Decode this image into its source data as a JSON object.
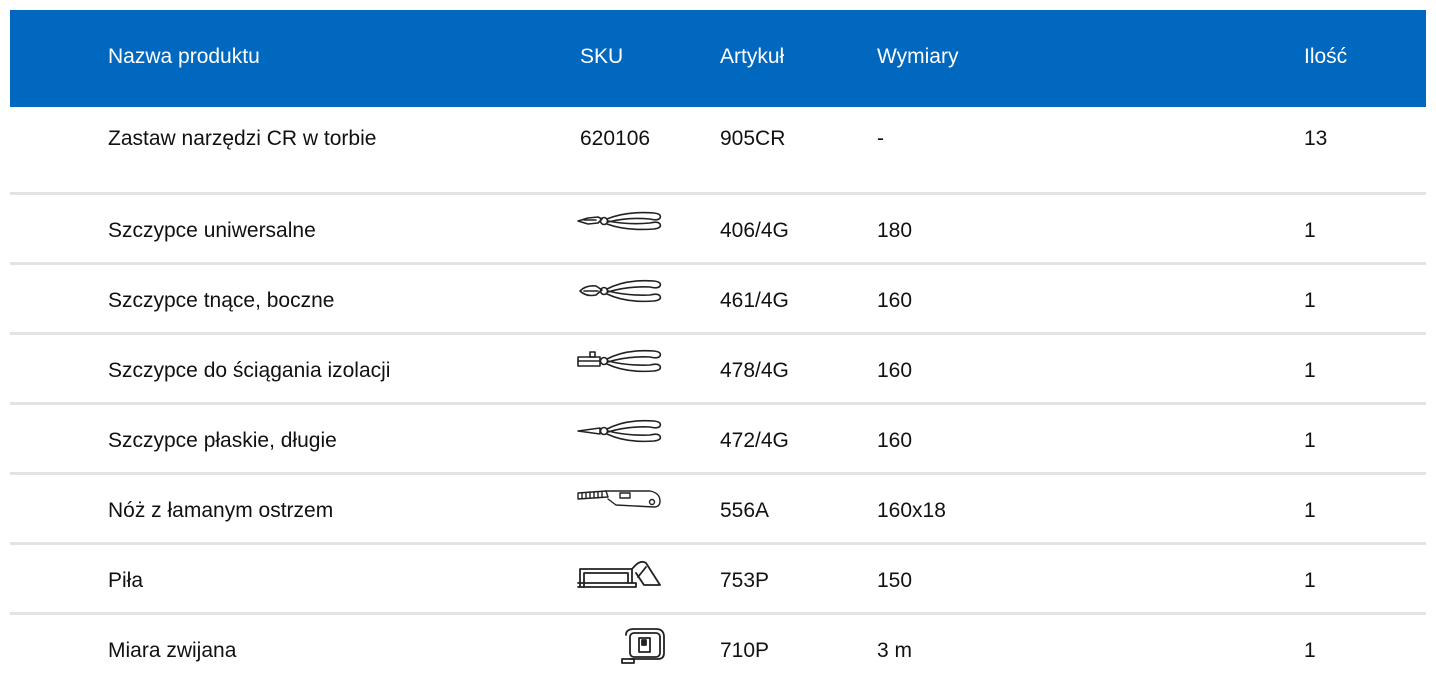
{
  "table": {
    "headers": {
      "name": "Nazwa produktu",
      "sku": "SKU",
      "article": "Artykuł",
      "dimensions": "Wymiary",
      "quantity": "Ilość"
    },
    "rows": [
      {
        "name": "Zastaw narzędzi CR w torbie",
        "sku": "620106",
        "article": "905CR",
        "dimensions": "-",
        "quantity": "13"
      },
      {
        "name": "Szczypce uniwersalne",
        "icon": "combination-pliers-icon",
        "article": "406/4G",
        "dimensions": "180",
        "quantity": "1"
      },
      {
        "name": "Szczypce tnące, boczne",
        "icon": "side-cutters-icon",
        "article": "461/4G",
        "dimensions": "160",
        "quantity": "1"
      },
      {
        "name": "Szczypce do ściągania izolacji",
        "icon": "wire-stripper-icon",
        "article": "478/4G",
        "dimensions": "160",
        "quantity": "1"
      },
      {
        "name": "Szczypce płaskie, długie",
        "icon": "long-nose-pliers-icon",
        "article": "472/4G",
        "dimensions": "160",
        "quantity": "1"
      },
      {
        "name": "Nóż z łamanym ostrzem",
        "icon": "snap-off-knife-icon",
        "article": "556A",
        "dimensions": "160x18",
        "quantity": "1"
      },
      {
        "name": "Piła",
        "icon": "hacksaw-icon",
        "article": "753P",
        "dimensions": "150",
        "quantity": "1"
      },
      {
        "name": "Miara zwijana",
        "icon": "tape-measure-icon",
        "article": "710P",
        "dimensions": "3 m",
        "quantity": "1"
      }
    ]
  },
  "colors": {
    "header_bg": "#0069bf",
    "header_text": "#ffffff",
    "row_divider": "#e3e3e3"
  }
}
